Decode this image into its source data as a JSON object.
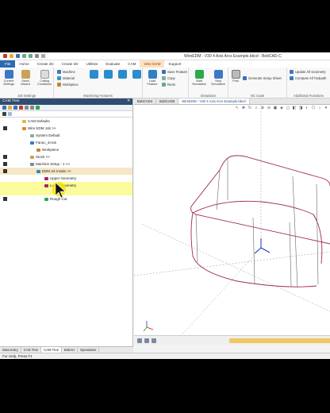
{
  "window": {
    "title": "WireEDM - V30 4 Axis Arcs Example.bbcd - BobCAD-C"
  },
  "ribbon_tabs": [
    "File",
    "Home",
    "Create 2D",
    "Create 3D",
    "Utilities",
    "Evaluate",
    "CAM",
    "Wire EDM",
    "Support"
  ],
  "ribbon": {
    "job_settings": {
      "label": "Job Settings",
      "current_settings": "Current Settings",
      "stock_wizard": "Stock Wizard",
      "cutting_conditions": "Cutting Conditions"
    },
    "machining_features": {
      "label": "Machining Features",
      "machine": "Machine",
      "material": "Material",
      "workpiece": "Workpiece"
    },
    "load": {
      "load_feature": "Load Feature",
      "save_feature": "Save Feature",
      "copy": "Copy",
      "redo": "Redo"
    },
    "simulation": {
      "label": "Simulation",
      "start": "Start Simulation",
      "stop": "Stop Simulation"
    },
    "nc_code": {
      "label": "NC Code",
      "post": "Post",
      "generate_setup_sheet": "Generate Setup Sheet"
    },
    "additional_functions": {
      "label": "Additional Functions",
      "update_all_geometry": "Update All Geometry",
      "compute_all_toolpath": "Compute All Toolpath"
    }
  },
  "cam_tree": {
    "title": "CAM Tree",
    "pin": " ✕",
    "items": [
      {
        "label": "CAM Defaults",
        "suffix": ""
      },
      {
        "label": "Wire EDM Job",
        "suffix": ">>"
      },
      {
        "label": "System Default",
        "suffix": ""
      },
      {
        "label": "Fanuc_4Axis",
        "suffix": ""
      },
      {
        "label": "Workpiece",
        "suffix": ""
      },
      {
        "label": "Stock",
        "suffix": ">>"
      },
      {
        "label": "Machine Setup - 1",
        "suffix": ">>"
      },
      {
        "label": "EDM 4X Inside",
        "suffix": ">>"
      },
      {
        "label": "Upper Geometry",
        "suffix": ""
      },
      {
        "label": "Lower Geometry",
        "suffix": ""
      },
      {
        "label": "Rough Cut",
        "suffix": ""
      }
    ]
  },
  "bottom_tabs": [
    "Data Entry",
    "CAD Tree",
    "CAM Tree",
    "BobArt",
    "Operations"
  ],
  "doc_tabs": [
    "BobCAD4",
    "BobCAD5",
    "WireEDM - V30 4 Axis Arcs Example.bbcd"
  ],
  "status": {
    "text": "For Help, Press F1"
  },
  "colors": {
    "file_tab": "#2e6ab1",
    "panel_header": "#2f4d71",
    "geometry": "#a3285e",
    "selection": "#f6e8c6",
    "highlight": "#fbfb9c"
  }
}
